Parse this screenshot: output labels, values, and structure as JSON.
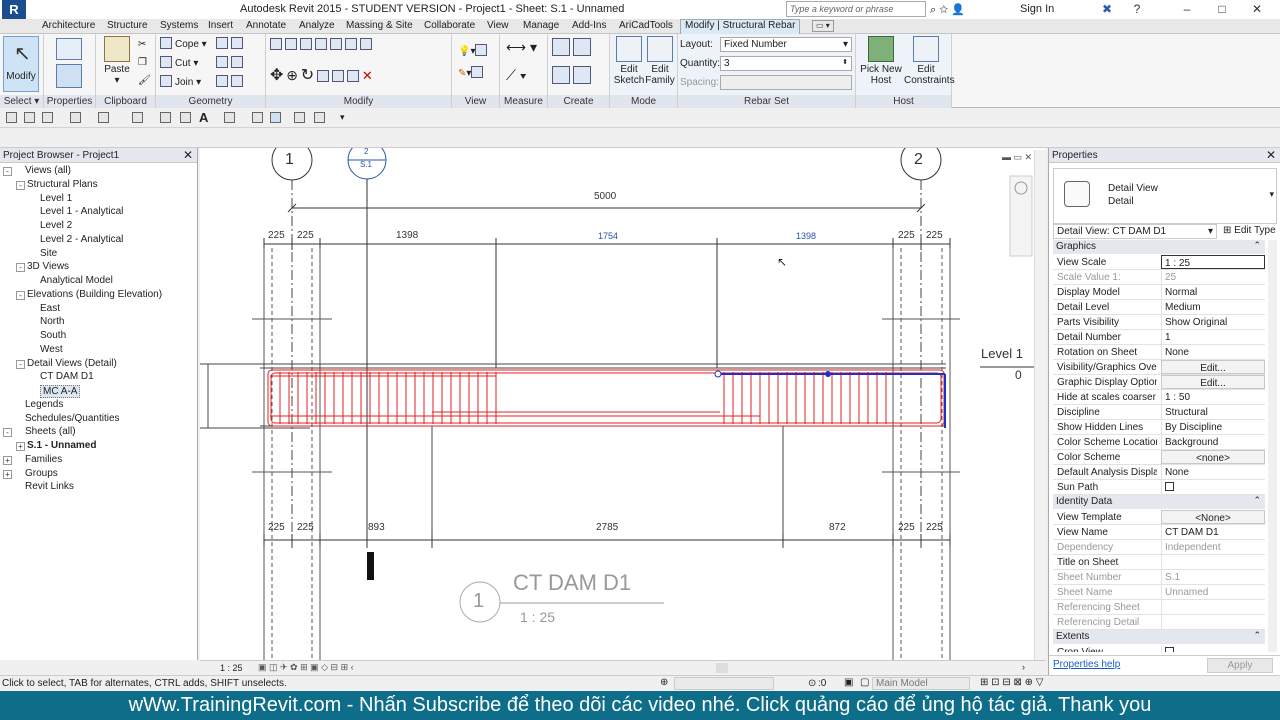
{
  "app": {
    "title": "Autodesk Revit 2015 - STUDENT VERSION -    Project1 - Sheet: S.1 - Unnamed",
    "logo": "R",
    "search_placeholder": "Type a keyword or phrase",
    "sign_in": "Sign In"
  },
  "tabs": [
    "Architecture",
    "Structure",
    "Systems",
    "Insert",
    "Annotate",
    "Analyze",
    "Massing & Site",
    "Collaborate",
    "View",
    "Manage",
    "Add-Ins",
    "AriCadTools",
    "Modify | Structural Rebar"
  ],
  "ribbon": {
    "select": {
      "modify": "Modify",
      "label": "Select"
    },
    "properties_label": "Properties",
    "clipboard": {
      "paste": "Paste",
      "label": "Clipboard"
    },
    "geometry": {
      "cope": "Cope",
      "cut": "Cut",
      "join": "Join",
      "label": "Geometry"
    },
    "modify_label": "Modify",
    "view_label": "View",
    "measure_label": "Measure",
    "create_label": "Create",
    "mode": {
      "edit_sketch": "Edit Sketch",
      "edit_family": "Edit Family",
      "label": "Mode"
    },
    "rebar_set": {
      "layout_label": "Layout:",
      "layout_value": "Fixed Number",
      "quantity_label": "Quantity:",
      "quantity_value": "3",
      "spacing_label": "Spacing:",
      "spacing_value": "",
      "label": "Rebar Set"
    },
    "host": {
      "pick_new_host": "Pick New Host",
      "edit_constraints": "Edit Constraints",
      "label": "Host"
    }
  },
  "project_browser": {
    "title": "Project Browser - Project1",
    "items": [
      {
        "label": "Views (all)",
        "level": 0,
        "exp": "-"
      },
      {
        "label": "Structural Plans",
        "level": 1,
        "exp": "-"
      },
      {
        "label": "Level 1",
        "level": 2
      },
      {
        "label": "Level 1 - Analytical",
        "level": 2
      },
      {
        "label": "Level 2",
        "level": 2
      },
      {
        "label": "Level 2 - Analytical",
        "level": 2
      },
      {
        "label": "Site",
        "level": 2
      },
      {
        "label": "3D Views",
        "level": 1,
        "exp": "-"
      },
      {
        "label": "Analytical Model",
        "level": 2
      },
      {
        "label": "Elevations (Building Elevation)",
        "level": 1,
        "exp": "-"
      },
      {
        "label": "East",
        "level": 2
      },
      {
        "label": "North",
        "level": 2
      },
      {
        "label": "South",
        "level": 2
      },
      {
        "label": "West",
        "level": 2
      },
      {
        "label": "Detail Views (Detail)",
        "level": 1,
        "exp": "-"
      },
      {
        "label": "CT DAM D1",
        "level": 2
      },
      {
        "label": "MC A-A",
        "level": 2,
        "selected": true
      },
      {
        "label": "Legends",
        "level": 0
      },
      {
        "label": "Schedules/Quantities",
        "level": 0
      },
      {
        "label": "Sheets (all)",
        "level": 0,
        "exp": "-"
      },
      {
        "label": "S.1 - Unnamed",
        "level": 1,
        "exp": "+",
        "bold": true
      },
      {
        "label": "Families",
        "level": 0,
        "exp": "+"
      },
      {
        "label": "Groups",
        "level": 0,
        "exp": "+"
      },
      {
        "label": "Revit Links",
        "level": 0
      }
    ]
  },
  "drawing": {
    "grid_left": "1",
    "grid_right": "2",
    "section_tag_top": "2",
    "section_tag_bottom": "S.1",
    "overall_dim": "5000",
    "top_dims": [
      "225",
      "225",
      "1398",
      "1754",
      "1398",
      "225",
      "225"
    ],
    "bottom_dims": [
      "225",
      "225",
      "893",
      "2785",
      "872",
      "225",
      "225"
    ],
    "level_name": "Level 1",
    "level_elev": "0",
    "view_number": "1",
    "view_title": "CT DAM D1",
    "view_scale": "1 : 25"
  },
  "canvas_status": {
    "scale": "1 : 25"
  },
  "properties": {
    "title": "Properties",
    "type_line1": "Detail View",
    "type_line2": "Detail",
    "selector": "Detail View: CT DAM D1",
    "edit_type": "Edit Type",
    "groups": {
      "graphics": "Graphics",
      "identity": "Identity Data",
      "extents": "Extents"
    },
    "rows": [
      {
        "k": "View Scale",
        "v": "1 : 25",
        "edit": true
      },
      {
        "k": "Scale Value    1:",
        "v": "25",
        "gray": true
      },
      {
        "k": "Display Model",
        "v": "Normal"
      },
      {
        "k": "Detail Level",
        "v": "Medium"
      },
      {
        "k": "Parts Visibility",
        "v": "Show Original"
      },
      {
        "k": "Detail Number",
        "v": "1"
      },
      {
        "k": "Rotation on Sheet",
        "v": "None"
      },
      {
        "k": "Visibility/Graphics Ove...",
        "v": "Edit...",
        "btn": true
      },
      {
        "k": "Graphic Display Options",
        "v": "Edit...",
        "btn": true
      },
      {
        "k": "Hide at scales coarser ...",
        "v": "1 : 50"
      },
      {
        "k": "Discipline",
        "v": "Structural"
      },
      {
        "k": "Show Hidden Lines",
        "v": "By Discipline"
      },
      {
        "k": "Color Scheme Location",
        "v": "Background"
      },
      {
        "k": "Color Scheme",
        "v": "<none>",
        "btn": true
      },
      {
        "k": "Default Analysis Displa...",
        "v": "None"
      },
      {
        "k": "Sun Path",
        "v": "",
        "check": true
      }
    ],
    "identity_rows": [
      {
        "k": "View Template",
        "v": "<None>",
        "btn": true
      },
      {
        "k": "View Name",
        "v": "CT DAM D1"
      },
      {
        "k": "Dependency",
        "v": "Independent",
        "gray": true
      },
      {
        "k": "Title on Sheet",
        "v": ""
      },
      {
        "k": "Sheet Number",
        "v": "S.1",
        "gray": true
      },
      {
        "k": "Sheet Name",
        "v": "Unnamed",
        "gray": true
      },
      {
        "k": "Referencing Sheet",
        "v": "",
        "gray": true
      },
      {
        "k": "Referencing Detail",
        "v": "",
        "gray": true
      }
    ],
    "extents_rows": [
      {
        "k": "Crop View",
        "v": "",
        "check": true
      }
    ],
    "help_link": "Properties help",
    "apply": "Apply"
  },
  "status": {
    "hint": "Click to select, TAB for alternates, CTRL adds, SHIFT unselects.",
    "zero": ":0",
    "model": "Main Model"
  },
  "banner": "wWw.TrainingRevit.com - Nhấn Subscribe để theo dõi các video nhé. Click quảng cáo để ủng hộ tác giả. Thank you"
}
